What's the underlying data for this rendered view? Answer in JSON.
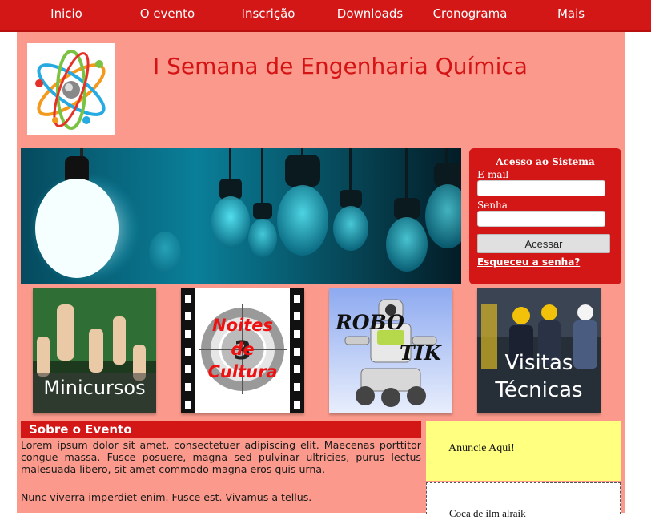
{
  "nav": {
    "items": [
      "Inicio",
      "O evento",
      "Inscrição",
      "Downloads",
      "Cronograma",
      "Mais"
    ]
  },
  "header": {
    "title": "I Semana de Engenharia Química"
  },
  "login": {
    "title": "Acesso ao Sistema",
    "email_label": "E-mail",
    "password_label": "Senha",
    "submit_label": "Acessar",
    "forgot_label": "Esqueceu a senha?"
  },
  "tiles": {
    "minicursos": "Minicursos",
    "noites": [
      "Noites",
      "de",
      "Cultura"
    ],
    "noites_number": "3",
    "robotik": [
      "ROBO",
      "TIK"
    ],
    "visitas": [
      "Visitas",
      "Técnicas"
    ]
  },
  "about": {
    "heading": "Sobre o Evento",
    "paragraph1": "Lorem ipsum dolor sit amet, consectetuer adipiscing elit. Maecenas porttitor congue massa. Fusce posuere, magna sed pulvinar ultricies, purus lectus malesuada libero, sit amet commodo magna eros quis urna.",
    "paragraph2": "Nunc viverra imperdiet enim. Fusce est. Vivamus a tellus."
  },
  "sidebar": {
    "ad_text": "Anuncie Aqui!",
    "box2_text": "Coca de ilm alraik"
  },
  "colors": {
    "brand_red": "#d31616",
    "page_bg": "#fb9a8c",
    "ad_yellow": "#ffff80"
  }
}
